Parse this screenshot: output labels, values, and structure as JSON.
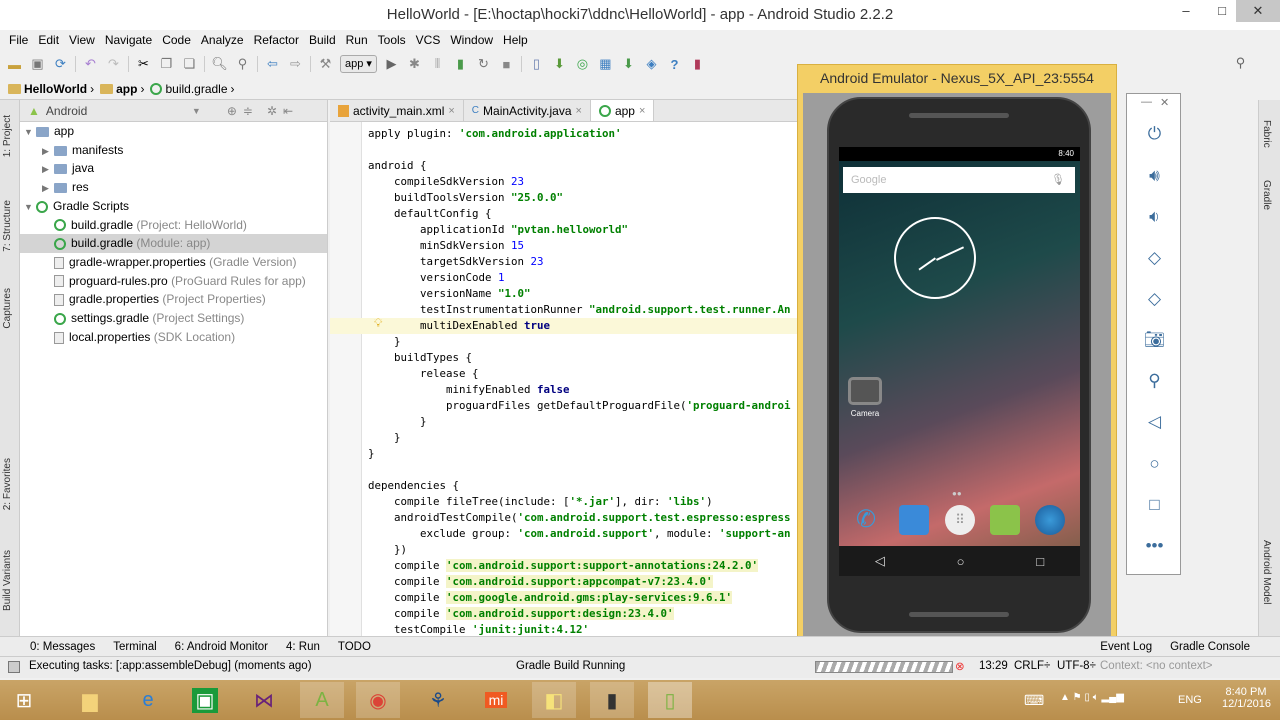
{
  "window": {
    "title": "HelloWorld - [E:\\hoctap\\hocki7\\ddnc\\HelloWorld] - app - Android Studio 2.2.2"
  },
  "menu": [
    "File",
    "Edit",
    "View",
    "Navigate",
    "Code",
    "Analyze",
    "Refactor",
    "Build",
    "Run",
    "Tools",
    "VCS",
    "Window",
    "Help"
  ],
  "toolbar": {
    "run_config": "app"
  },
  "breadcrumb": [
    "HelloWorld",
    "app",
    "build.gradle"
  ],
  "project": {
    "view": "Android",
    "tree": [
      {
        "label": "app",
        "sub": "",
        "level": 0,
        "type": "folder",
        "open": true
      },
      {
        "label": "manifests",
        "sub": "",
        "level": 1,
        "type": "folder"
      },
      {
        "label": "java",
        "sub": "",
        "level": 1,
        "type": "folder"
      },
      {
        "label": "res",
        "sub": "",
        "level": 1,
        "type": "folder"
      },
      {
        "label": "Gradle Scripts",
        "sub": "",
        "level": 0,
        "type": "gradle",
        "open": true
      },
      {
        "label": "build.gradle",
        "sub": "(Project: HelloWorld)",
        "level": 1,
        "type": "gradle"
      },
      {
        "label": "build.gradle",
        "sub": "(Module: app)",
        "level": 1,
        "type": "gradle",
        "selected": true
      },
      {
        "label": "gradle-wrapper.properties",
        "sub": "(Gradle Version)",
        "level": 1,
        "type": "file"
      },
      {
        "label": "proguard-rules.pro",
        "sub": "(ProGuard Rules for app)",
        "level": 1,
        "type": "file"
      },
      {
        "label": "gradle.properties",
        "sub": "(Project Properties)",
        "level": 1,
        "type": "file"
      },
      {
        "label": "settings.gradle",
        "sub": "(Project Settings)",
        "level": 1,
        "type": "gradle"
      },
      {
        "label": "local.properties",
        "sub": "(SDK Location)",
        "level": 1,
        "type": "file"
      }
    ]
  },
  "left_tabs": [
    "1: Project",
    "7: Structure",
    "Captures",
    "2: Favorites",
    "Build Variants"
  ],
  "right_tabs": [
    "Fabric",
    "Gradle",
    "Android Model"
  ],
  "editor_tabs": [
    {
      "label": "activity_main.xml",
      "active": false
    },
    {
      "label": "MainActivity.java",
      "active": false
    },
    {
      "label": "app",
      "active": true
    }
  ],
  "code": [
    "apply plugin: 'com.android.application'",
    "",
    "android {",
    "    compileSdkVersion 23",
    "    buildToolsVersion \"25.0.0\"",
    "    defaultConfig {",
    "        applicationId \"pvtan.helloworld\"",
    "        minSdkVersion 15",
    "        targetSdkVersion 23",
    "        versionCode 1",
    "        versionName \"1.0\"",
    "        testInstrumentationRunner \"android.support.test.runner.An",
    "        multiDexEnabled true",
    "    }",
    "    buildTypes {",
    "        release {",
    "            minifyEnabled false",
    "            proguardFiles getDefaultProguardFile('proguard-androi",
    "        }",
    "    }",
    "}",
    "",
    "dependencies {",
    "    compile fileTree(include: ['*.jar'], dir: 'libs')",
    "    androidTestCompile('com.android.support.test.espresso:espress",
    "        exclude group: 'com.android.support', module: 'support-an",
    "    })",
    "    compile 'com.android.support:support-annotations:24.2.0'",
    "    compile 'com.android.support:appcompat-v7:23.4.0'",
    "    compile 'com.google.android.gms:play-services:9.6.1'",
    "    compile 'com.android.support:design:23.4.0'",
    "    testCompile 'junit:junit:4.12'"
  ],
  "emulator": {
    "title": "Android Emulator - Nexus_5X_API_23:5554",
    "time": "8:40",
    "search_placeholder": "Google",
    "app_label": "Camera"
  },
  "bottom_tabs": [
    "0: Messages",
    "Terminal",
    "6: Android Monitor",
    "4: Run",
    "TODO"
  ],
  "bottom_right_tabs": [
    "Event Log",
    "Gradle Console"
  ],
  "status": {
    "left": "Executing tasks: [:app:assembleDebug] (moments ago)",
    "center": "Gradle Build Running",
    "position": "13:29",
    "line_sep": "CRLF÷",
    "encoding": "UTF-8÷",
    "context": "Context: <no context>"
  },
  "taskbar": {
    "lang": "ENG",
    "time": "8:40 PM",
    "date": "12/1/2016"
  }
}
